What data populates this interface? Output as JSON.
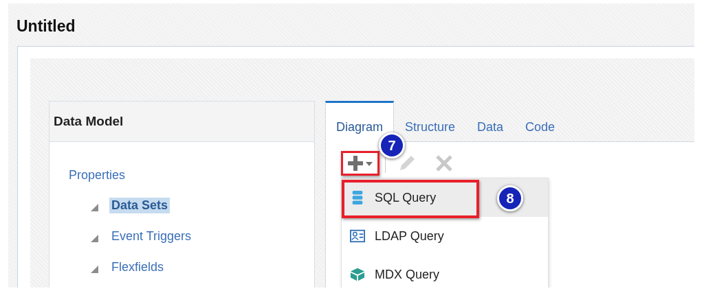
{
  "window": {
    "title": "Untitled"
  },
  "data_model": {
    "title": "Data Model",
    "tree": [
      {
        "label": "Properties",
        "selected": false,
        "children": [
          {
            "label": "Data Sets",
            "expanded": true,
            "selected": true
          },
          {
            "label": "Event Triggers",
            "expanded": true,
            "selected": false
          },
          {
            "label": "Flexfields",
            "expanded": true,
            "selected": false
          }
        ]
      }
    ]
  },
  "tabs": [
    {
      "label": "Diagram",
      "selected": true
    },
    {
      "label": "Structure",
      "selected": false
    },
    {
      "label": "Data",
      "selected": false
    },
    {
      "label": "Code",
      "selected": false
    }
  ],
  "toolbar": [
    {
      "kind": "add",
      "disabled": false,
      "highlighted": true,
      "callout": "7"
    },
    {
      "kind": "edit",
      "disabled": true,
      "highlighted": false
    },
    {
      "kind": "delete",
      "disabled": true,
      "highlighted": false
    }
  ],
  "menu": [
    {
      "kind": "sql",
      "label": "SQL Query",
      "selected": true,
      "highlighted": true,
      "callout": "8"
    },
    {
      "kind": "ldap",
      "label": "LDAP Query",
      "selected": false,
      "highlighted": false
    },
    {
      "kind": "mdx",
      "label": "MDX Query",
      "selected": false,
      "highlighted": false
    }
  ]
}
